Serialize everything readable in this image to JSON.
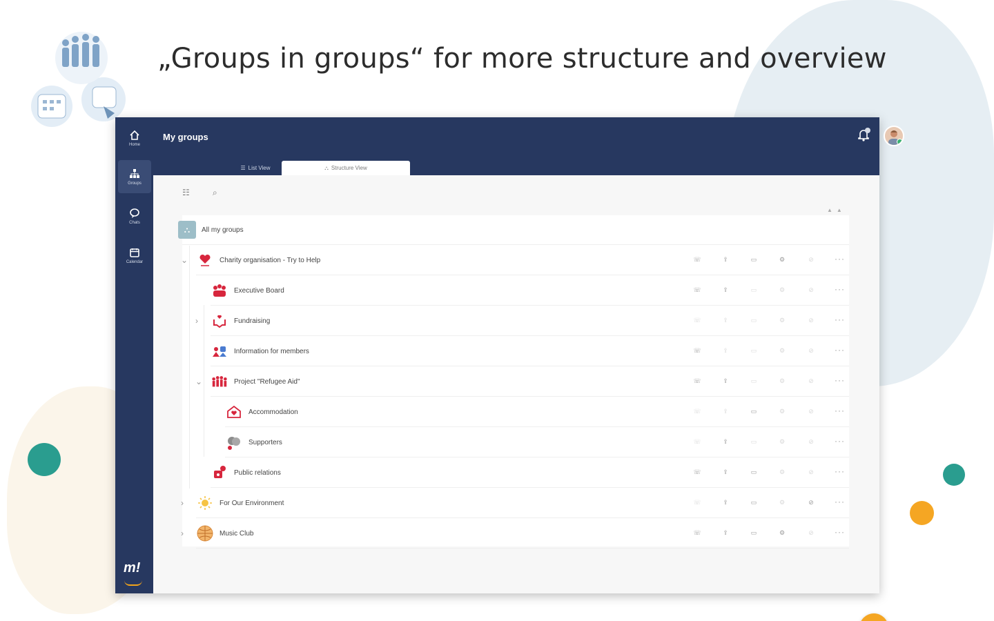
{
  "headline": "„Groups in groups“ for more structure and overview",
  "nav": [
    {
      "label": "Home",
      "icon": "home-icon"
    },
    {
      "label": "Groups",
      "icon": "groups-icon"
    },
    {
      "label": "Chats",
      "icon": "chat-icon"
    },
    {
      "label": "Calendar",
      "icon": "calendar-icon"
    }
  ],
  "app": {
    "logo": "m!",
    "title": "My groups",
    "tabs": [
      {
        "label": "List View",
        "icon": "list-view-icon"
      },
      {
        "label": "Structure View",
        "icon": "structure-icon"
      }
    ]
  },
  "tree": {
    "root_label": "All my groups",
    "groups": [
      {
        "name": "Charity organisation - Try to Help",
        "icon": "heart-icon",
        "level": 0,
        "chevron": "down"
      },
      {
        "name": "Executive Board",
        "icon": "team-icon",
        "level": 1,
        "chevron": ""
      },
      {
        "name": "Fundraising",
        "icon": "helping-hand-icon",
        "level": 1,
        "chevron": "right"
      },
      {
        "name": "Information for members",
        "icon": "info-people-icon",
        "level": 1,
        "chevron": ""
      },
      {
        "name": "Project \"Refugee Aid\"",
        "icon": "crowd-icon",
        "level": 1,
        "chevron": "down"
      },
      {
        "name": "Accommodation",
        "icon": "house-heart-icon",
        "level": 2,
        "chevron": ""
      },
      {
        "name": "Supporters",
        "icon": "supporters-icon",
        "level": 2,
        "chevron": ""
      },
      {
        "name": "Public relations",
        "icon": "megaphone-icon",
        "level": 1,
        "chevron": ""
      },
      {
        "name": "For Our Environment",
        "icon": "sun-icon",
        "level": 0,
        "chevron": "right"
      },
      {
        "name": "Music Club",
        "icon": "globe-icon",
        "level": 0,
        "chevron": "right"
      }
    ]
  },
  "colors": {
    "navy": "#273860",
    "accent": "#f5a623",
    "teal": "#2a9d8f",
    "red": "#d7263d"
  }
}
